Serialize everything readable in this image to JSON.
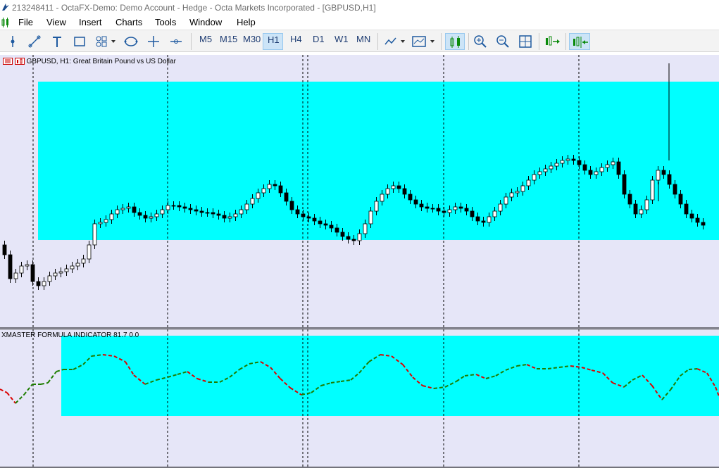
{
  "window": {
    "title": "213248411 - OctaFX-Demo: Demo Account - Hedge - Octa Markets Incorporated - [GBPUSD,H1]"
  },
  "menu": {
    "items": [
      "File",
      "View",
      "Insert",
      "Charts",
      "Tools",
      "Window",
      "Help"
    ]
  },
  "toolbar": {
    "drawing_tools": [
      "cursor-icon",
      "trendline-icon",
      "text-icon",
      "rectangle-icon",
      "shapes-icon",
      "object-icon",
      "crosshair-icon",
      "hline-icon"
    ],
    "timeframes": [
      "M5",
      "M15",
      "M30",
      "H1",
      "H4",
      "D1",
      "W1",
      "MN"
    ],
    "active_timeframe": "H1",
    "chart_tools": [
      "indicators-icon",
      "template-icon",
      "candles-icon",
      "zoom-in-icon",
      "zoom-out-icon",
      "tile-icon",
      "autoscroll-icon",
      "chart-shift-icon"
    ]
  },
  "chart": {
    "symbol_header": "GBPUSD, H1:  Great Britain Pound vs US Dollar",
    "subwindow_header": "XMASTER FORMULA INDICATOR 81.7 0.0",
    "colors": {
      "background": "#e6e6f8",
      "highlight": "#00ffff",
      "bull": "#ffffff",
      "bear": "#000000",
      "up_line": "#1e7d00",
      "down_line": "#dc0000"
    }
  }
}
